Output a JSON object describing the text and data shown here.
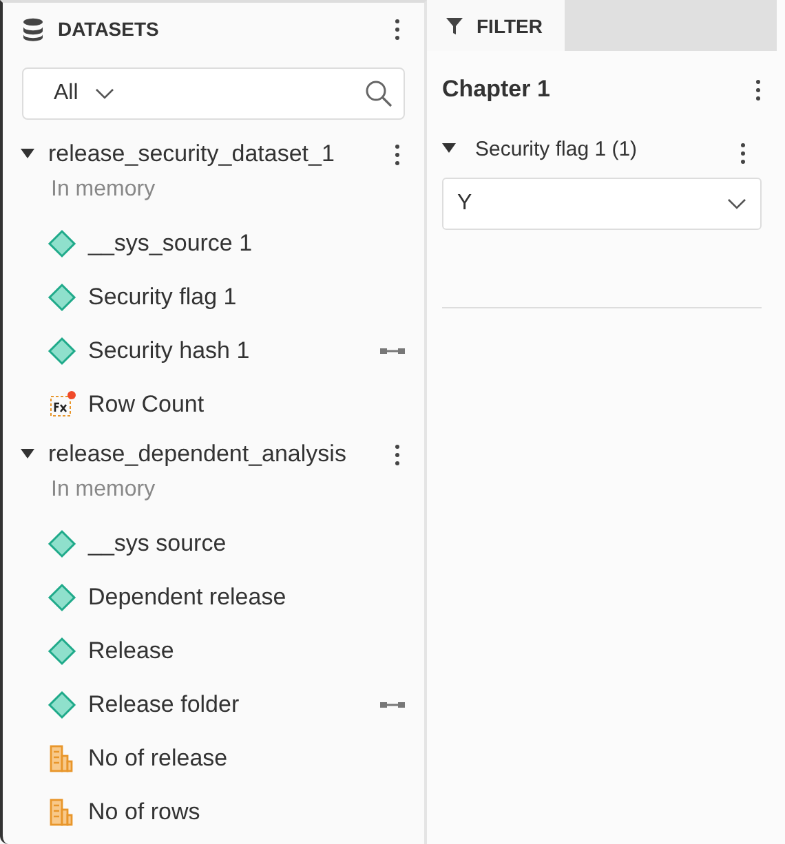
{
  "datasets_panel": {
    "title": "DATASETS",
    "filter": {
      "value": "All"
    },
    "datasets": [
      {
        "name": "release_security_dataset_1",
        "expanded": true,
        "status": "In memory",
        "fields": [
          {
            "name": "__sys_source 1",
            "kind": "dimension",
            "linked": false
          },
          {
            "name": "Security flag 1",
            "kind": "dimension",
            "linked": false
          },
          {
            "name": "Security hash 1",
            "kind": "dimension",
            "linked": true
          },
          {
            "name": "Row Count",
            "kind": "formula",
            "linked": false
          }
        ]
      },
      {
        "name": "release_dependent_analysis",
        "expanded": true,
        "status": "In memory",
        "fields": [
          {
            "name": "__sys source",
            "kind": "dimension",
            "linked": false
          },
          {
            "name": "Dependent release",
            "kind": "dimension",
            "linked": false
          },
          {
            "name": "Release",
            "kind": "dimension",
            "linked": false
          },
          {
            "name": "Release folder",
            "kind": "dimension",
            "linked": true
          },
          {
            "name": "No of release",
            "kind": "measure",
            "linked": false
          },
          {
            "name": "No of rows",
            "kind": "measure",
            "linked": false
          }
        ]
      }
    ]
  },
  "filter_panel": {
    "tab": {
      "label": "FILTER",
      "selected": true
    },
    "chapter": "Chapter 1",
    "filters": [
      {
        "label": "Security flag 1 (1)",
        "expanded": true,
        "value": "Y"
      }
    ]
  }
}
